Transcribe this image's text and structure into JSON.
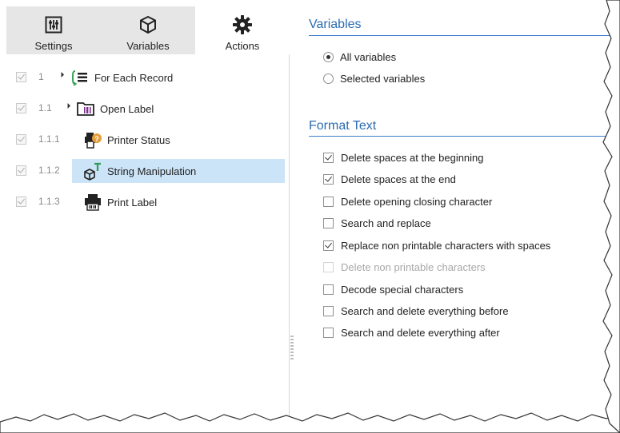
{
  "tabs": [
    {
      "label": "Settings",
      "icon": "sliders-icon",
      "active": false
    },
    {
      "label": "Variables",
      "icon": "cube-icon",
      "active": false
    },
    {
      "label": "Actions",
      "icon": "gear-icon",
      "active": true
    }
  ],
  "tree": [
    {
      "number": "1",
      "label": "For Each Record",
      "icon": "loop-list-icon",
      "checked": true,
      "selected": false
    },
    {
      "number": "1.1",
      "label": "Open Label",
      "icon": "open-label-icon",
      "checked": true,
      "selected": false
    },
    {
      "number": "1.1.1",
      "label": "Printer Status",
      "icon": "printer-status-icon",
      "checked": true,
      "selected": false
    },
    {
      "number": "1.1.2",
      "label": "String Manipulation",
      "icon": "string-manipulation-icon",
      "checked": true,
      "selected": true
    },
    {
      "number": "1.1.3",
      "label": "Print Label",
      "icon": "printer-icon",
      "checked": true,
      "selected": false
    }
  ],
  "variables": {
    "title": "Variables",
    "options": [
      {
        "label": "All variables",
        "selected": true
      },
      {
        "label": "Selected variables",
        "selected": false
      }
    ]
  },
  "format_text": {
    "title": "Format Text",
    "options": [
      {
        "label": "Delete spaces at the beginning",
        "checked": true,
        "disabled": false
      },
      {
        "label": "Delete spaces at the end",
        "checked": true,
        "disabled": false
      },
      {
        "label": "Delete opening closing character",
        "checked": false,
        "disabled": false
      },
      {
        "label": "Search and replace",
        "checked": false,
        "disabled": false
      },
      {
        "label": "Replace non printable characters with spaces",
        "checked": true,
        "disabled": false
      },
      {
        "label": "Delete non printable characters",
        "checked": false,
        "disabled": true
      },
      {
        "label": "Decode special characters",
        "checked": false,
        "disabled": false
      },
      {
        "label": "Search and delete everything before",
        "checked": false,
        "disabled": false
      },
      {
        "label": "Search and delete everything after",
        "checked": false,
        "disabled": false
      }
    ]
  },
  "colors": {
    "accent": "#2b6cb0",
    "selection": "#cce4f7",
    "tab_bar": "#e6e6e6"
  }
}
